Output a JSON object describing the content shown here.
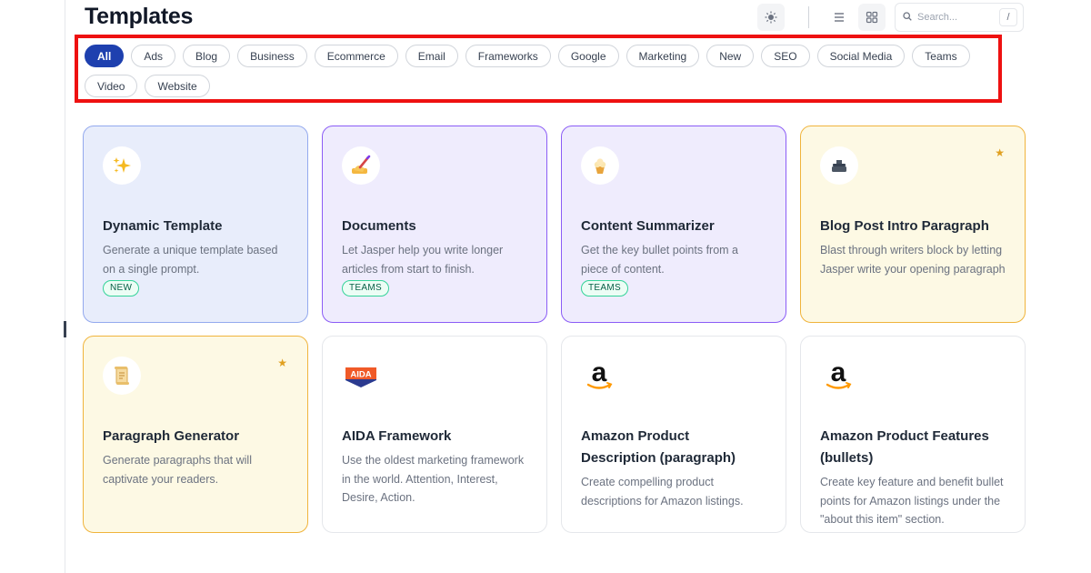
{
  "header": {
    "title": "Templates",
    "search_placeholder": "Search...",
    "search_shortcut": "/"
  },
  "filters": {
    "active": "All",
    "items": [
      "All",
      "Ads",
      "Blog",
      "Business",
      "Ecommerce",
      "Email",
      "Frameworks",
      "Google",
      "Marketing",
      "New",
      "SEO",
      "Social Media",
      "Teams",
      "Video",
      "Website"
    ]
  },
  "colors": {
    "accent": "#1e40af",
    "highlight_border": "#ee1111",
    "star": "#e0a020",
    "amazon_orange": "#ff9900"
  },
  "cards": [
    {
      "title": "Dynamic Template",
      "description": "Generate a unique template based on a single prompt.",
      "badge": "NEW",
      "icon": "sparkles-icon",
      "starred": false
    },
    {
      "title": "Documents",
      "description": "Let Jasper help you write longer articles from start to finish.",
      "badge": "TEAMS",
      "icon": "writing-hand-icon",
      "starred": false
    },
    {
      "title": "Content Summarizer",
      "description": "Get the key bullet points from a piece of content.",
      "badge": "TEAMS",
      "icon": "cupcake-icon",
      "starred": false
    },
    {
      "title": "Blog Post Intro Paragraph",
      "description": "Blast through writers block by letting Jasper write your opening paragraph",
      "icon": "typewriter-icon",
      "starred": true
    },
    {
      "title": "Paragraph Generator",
      "description": "Generate paragraphs that will captivate your readers.",
      "icon": "scroll-icon",
      "starred": true
    },
    {
      "title": "AIDA Framework",
      "description": "Use the oldest marketing framework in the world. Attention, Interest, Desire, Action.",
      "icon_text": "AIDA",
      "icon": "aida-logo-icon",
      "starred": false
    },
    {
      "title": "Amazon Product Description (paragraph)",
      "description": "Create compelling product descriptions for Amazon listings.",
      "icon": "amazon-logo-icon",
      "starred": false
    },
    {
      "title": "Amazon Product Features (bullets)",
      "description": "Create key feature and benefit bullet points for Amazon listings under the \"about this item\" section.",
      "icon": "amazon-logo-icon",
      "starred": false
    }
  ]
}
